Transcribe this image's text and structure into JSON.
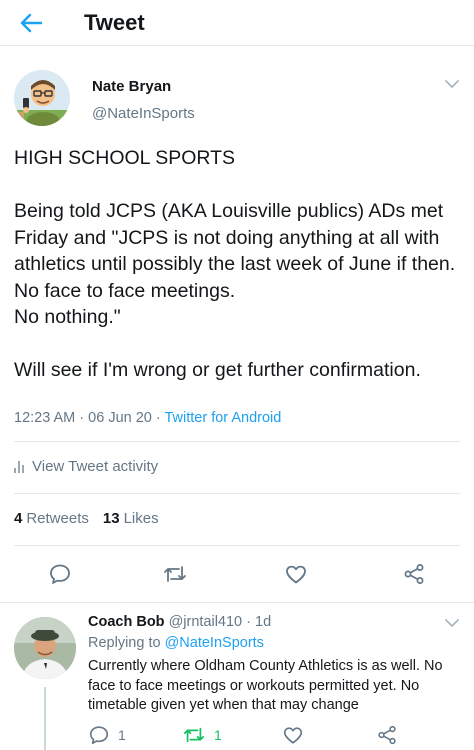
{
  "header": {
    "title": "Tweet"
  },
  "author": {
    "name": "Nate Bryan",
    "handle": "@NateInSports"
  },
  "tweet": {
    "text": "HIGH SCHOOL SPORTS\n\nBeing told JCPS (AKA Louisville publics) ADs met Friday and \"JCPS is not doing anything at all with athletics until possibly the last week of June if then.\nNo face to face meetings.\nNo nothing.\"\n\nWill see if I'm wrong or get further confirmation.",
    "time": "12:23 AM",
    "date": "06 Jun 20",
    "separator": " · ",
    "source": "Twitter for Android"
  },
  "activity": {
    "label": "View Tweet activity"
  },
  "stats": {
    "retweets_count": "4",
    "retweets_label": "Retweets",
    "likes_count": "13",
    "likes_label": "Likes"
  },
  "reply": {
    "name": "Coach Bob",
    "handle": "@jrntail410",
    "age": " · 1d",
    "replying_prefix": "Replying to ",
    "replying_to": "@NateInSports",
    "text": "Currently where Oldham County Athletics is as well. No face to face meetings or workouts permitted yet. No timetable given yet when that may change",
    "reply_count": "1",
    "retweet_count": "1"
  },
  "colors": {
    "accent": "#1da1f2",
    "retweet": "#17bf63",
    "secondary": "#657786",
    "icon": "#657786"
  },
  "icons": [
    "back-arrow-icon",
    "chevron-down-icon",
    "reply-icon",
    "retweet-icon",
    "like-icon",
    "share-icon",
    "activity-bars-icon"
  ]
}
